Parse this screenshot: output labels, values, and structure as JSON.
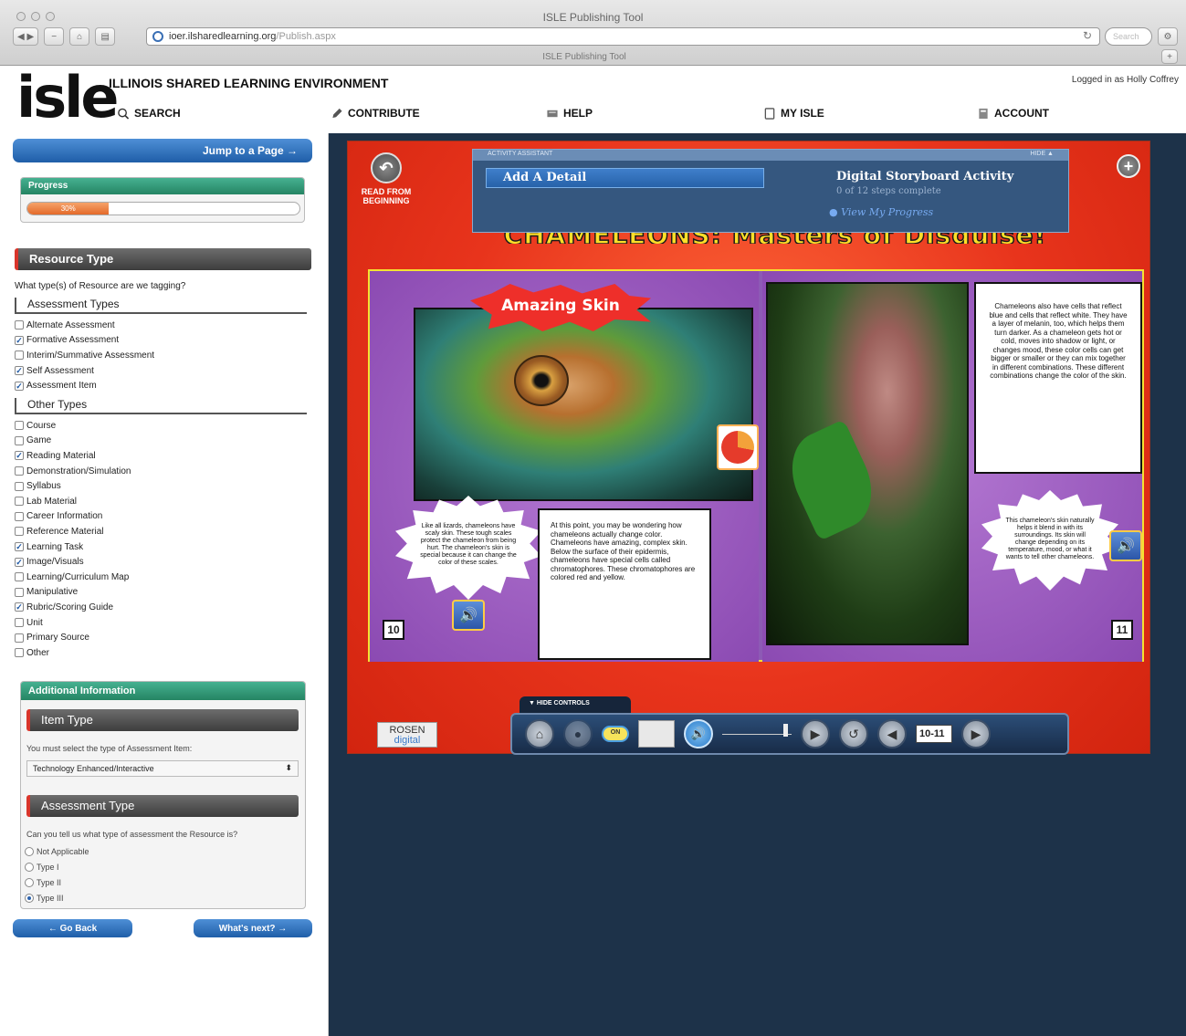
{
  "browser": {
    "window_title": "ISLE Publishing Tool",
    "url_main": "ioer.ilsharedlearning.org",
    "url_path": "/Publish.aspx",
    "search_placeholder": "Search",
    "tab_title": "ISLE Publishing Tool"
  },
  "header": {
    "logo": "isle",
    "org_name": "ILLINOIS SHARED LEARNING ENVIRONMENT",
    "logged_in": "Logged in as Holly Coffrey",
    "nav": {
      "search": "SEARCH",
      "contribute": "CONTRIBUTE",
      "help": "HELP",
      "my_isle": "MY ISLE",
      "account": "ACCOUNT"
    }
  },
  "left": {
    "jump_label": "Jump to a Page →",
    "progress": {
      "label": "Progress",
      "value_text": "30%",
      "value": 0.3
    },
    "resource_type": {
      "title": "Resource Type",
      "question": "What type(s) of Resource are we tagging?",
      "assessment_title": "Assessment Types",
      "assessment_types": [
        {
          "label": "Alternate Assessment",
          "checked": false
        },
        {
          "label": "Formative Assessment",
          "checked": true
        },
        {
          "label": "Interim/Summative Assessment",
          "checked": false
        },
        {
          "label": "Self Assessment",
          "checked": true
        },
        {
          "label": "Assessment Item",
          "checked": true
        }
      ],
      "other_title": "Other Types",
      "other_types": [
        {
          "label": "Course",
          "checked": false
        },
        {
          "label": "Game",
          "checked": false
        },
        {
          "label": "Reading Material",
          "checked": true
        },
        {
          "label": "Demonstration/Simulation",
          "checked": false
        },
        {
          "label": "Syllabus",
          "checked": false
        },
        {
          "label": "Lab Material",
          "checked": false
        },
        {
          "label": "Career Information",
          "checked": false
        },
        {
          "label": "Reference Material",
          "checked": false
        },
        {
          "label": "Learning Task",
          "checked": true
        },
        {
          "label": "Image/Visuals",
          "checked": true
        },
        {
          "label": "Learning/Curriculum Map",
          "checked": false
        },
        {
          "label": "Manipulative",
          "checked": false
        },
        {
          "label": "Rubric/Scoring Guide",
          "checked": true
        },
        {
          "label": "Unit",
          "checked": false
        },
        {
          "label": "Primary Source",
          "checked": false
        },
        {
          "label": "Other",
          "checked": false
        }
      ]
    },
    "additional": {
      "title": "Additional Information",
      "item_type_title": "Item Type",
      "item_type_question": "You must select the type of Assessment Item:",
      "item_type_value": "Technology Enhanced/Interactive",
      "assessment_type_title": "Assessment Type",
      "assessment_type_question": "Can you tell us what type of assessment the Resource is?",
      "options": [
        {
          "label": "Not Applicable",
          "selected": false
        },
        {
          "label": "Type I",
          "selected": false
        },
        {
          "label": "Type II",
          "selected": false
        },
        {
          "label": "Type III",
          "selected": true
        }
      ]
    },
    "go_back": "← Go Back",
    "whats_next": "What's next? →"
  },
  "book": {
    "read_from_beginning": "READ FROM BEGINNING",
    "assistant": {
      "header": "ACTIVITY ASSISTANT",
      "hide": "HIDE ▲",
      "add_detail": "Add A Detail",
      "activity_title": "Digital Storyboard Activity",
      "steps": "0 of 12 steps complete",
      "link": "View My Progress"
    },
    "title": "CHAMELEONS: Masters of Disguise!",
    "burst": "Amazing Skin",
    "speech_left": "Like all lizards, chameleons have scaly skin. These tough scales protect the chameleon from being hurt. The chameleon's skin is special because it can change the color of these scales.",
    "text_left": "At this point, you may be wondering how chameleons actually change color. Chameleons have amazing, complex skin. Below the surface of their epidermis, chameleons have special cells called chromatophores. These chromatophores are colored red and yellow.",
    "text_right": "Chameleons also have cells that reflect blue and cells that reflect white. They have a layer of melanin, too, which helps them turn darker. As a chameleon gets hot or cold, moves into shadow or light, or changes mood, these color cells can get bigger or smaller or they can mix together in different combinations. These different combinations change the color of the skin.",
    "speech_right": "This chameleon's skin naturally helps it blend in with its surroundings. Its skin will change depending on its temperature, mood, or what it wants to tell other chameleons.",
    "page_left": "10",
    "page_right": "11",
    "publisher": {
      "line1": "ROSEN",
      "line2": "digital"
    },
    "hide_controls": "▼  HIDE CONTROLS",
    "on_label": "ON",
    "page_field": "10-11"
  }
}
